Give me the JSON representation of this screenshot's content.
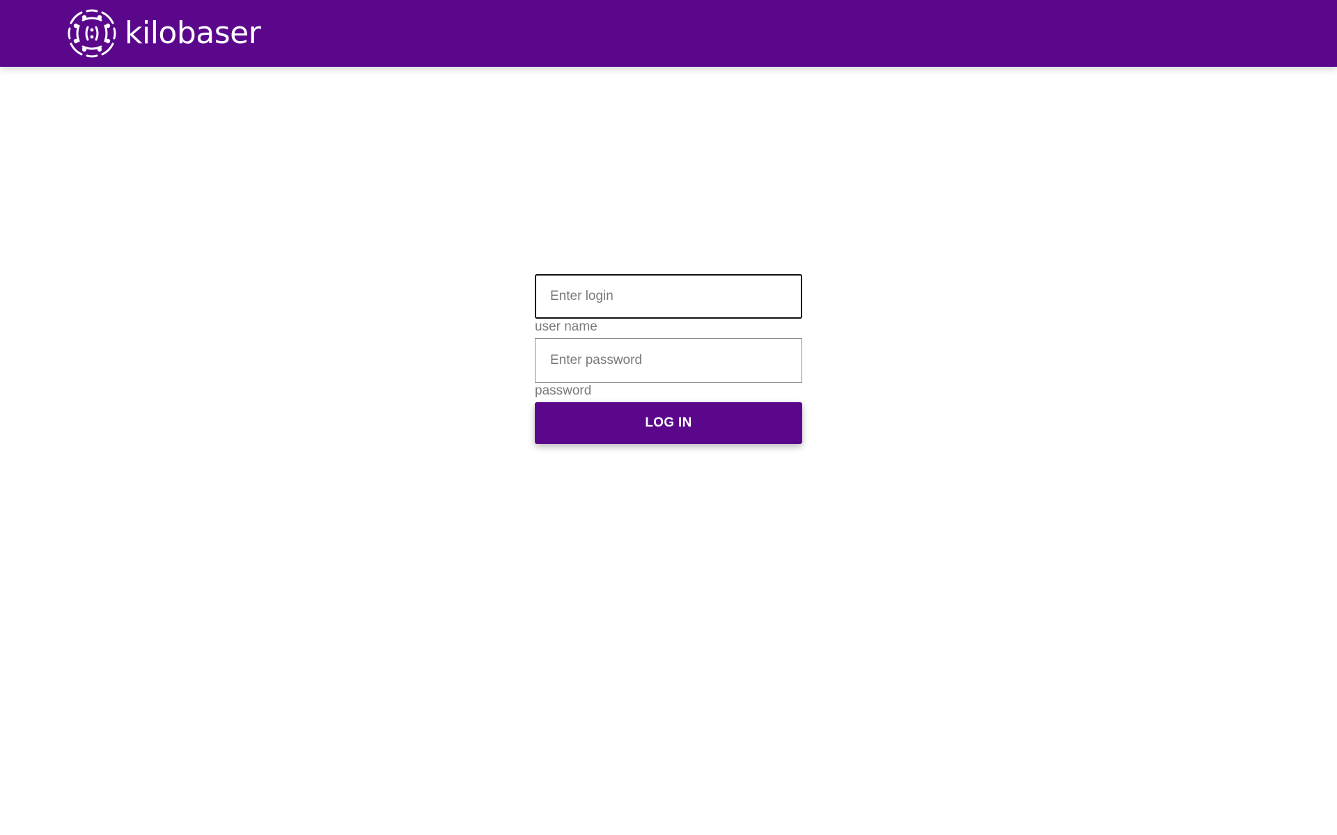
{
  "header": {
    "brand_name": "kilobaser",
    "background_color": "#5b078b",
    "logo_icon": "kilobaser-logo-icon"
  },
  "login": {
    "username": {
      "value": "",
      "placeholder": "Enter login",
      "label": "user name"
    },
    "password": {
      "value": "",
      "placeholder": "Enter password",
      "label": "password"
    },
    "submit_label": "LOG IN",
    "accent_color": "#5b078b"
  }
}
